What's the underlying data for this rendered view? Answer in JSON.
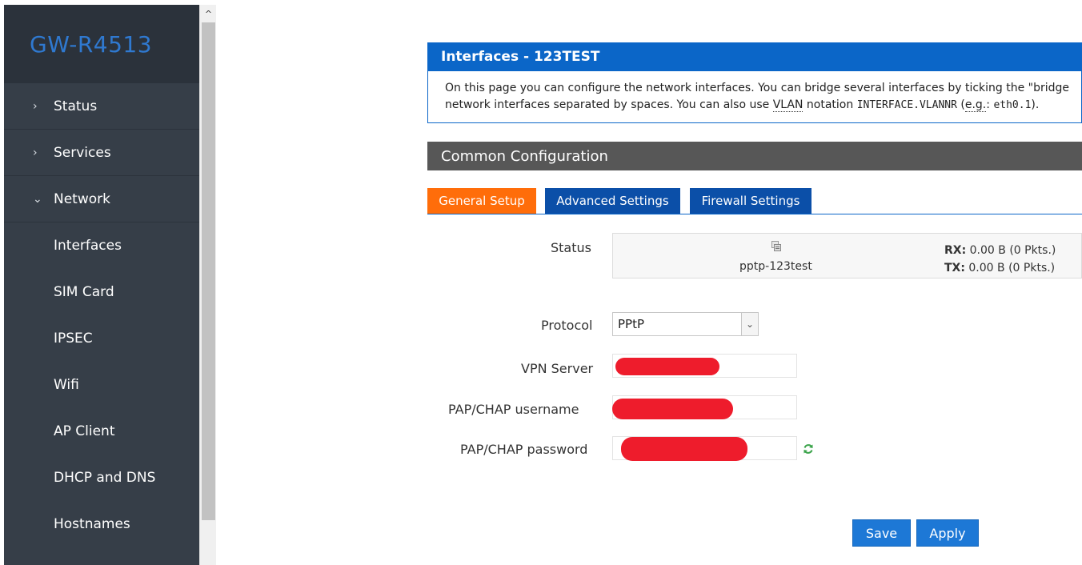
{
  "sidebar": {
    "brand": "GW-R4513",
    "items": [
      {
        "label": "Status",
        "chevron": "›"
      },
      {
        "label": "Services",
        "chevron": "›"
      },
      {
        "label": "Network",
        "chevron": "⌄"
      }
    ],
    "subitems": [
      "Interfaces",
      "SIM Card",
      "IPSEC",
      "Wifi",
      "AP Client",
      "DHCP and DNS",
      "Hostnames"
    ]
  },
  "scrollbar": {
    "up_arrow": "^"
  },
  "header": {
    "title": "Interfaces - 123TEST",
    "desc_line1": "On this page you can configure the network interfaces. You can bridge several interfaces by ticking the \"bridge",
    "desc_line2_a": "network interfaces separated by spaces. You can also use ",
    "desc_line2_vlan": "VLAN",
    "desc_line2_b": " notation ",
    "desc_line2_code": "INTERFACE.VLANNR",
    "desc_line2_c": " (",
    "desc_line2_eg": "e.g.",
    "desc_line2_d": ": ",
    "desc_line2_code2": "eth0.1",
    "desc_line2_e": ")."
  },
  "section": {
    "title": "Common Configuration"
  },
  "tabs": [
    {
      "label": "General Setup",
      "active": true
    },
    {
      "label": "Advanced Settings",
      "active": false
    },
    {
      "label": "Firewall Settings",
      "active": false
    }
  ],
  "status": {
    "label": "Status",
    "icon": "network-interface-icon",
    "ifname": "pptp-123test",
    "rx_label": "RX:",
    "rx_value": " 0.00 B (0 Pkts.)",
    "tx_label": "TX:",
    "tx_value": " 0.00 B (0 Pkts.)"
  },
  "form": {
    "protocol_label": "Protocol",
    "protocol_value": "PPtP",
    "vpn_server_label": "VPN Server",
    "username_label": "PAP/CHAP username",
    "password_label": "PAP/CHAP password"
  },
  "buttons": {
    "save": "Save",
    "apply": "Apply"
  },
  "colors": {
    "sidebar_bg": "#363e48",
    "brand_text": "#2f79d0",
    "header_blue": "#0b66c8",
    "tab_active": "#ff6d0a",
    "tab_normal": "#0b4fa8",
    "button_blue": "#1d78d6",
    "redaction": "#ee1c2c"
  }
}
